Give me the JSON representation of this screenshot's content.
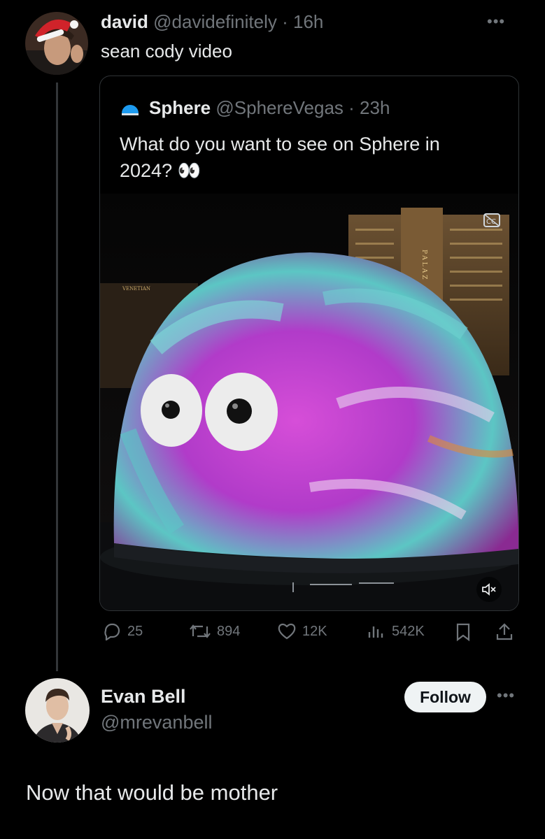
{
  "tweet": {
    "author_name": "david",
    "author_handle": "@davidefinitely",
    "time": "· 16h",
    "text": "sean cody video"
  },
  "quote": {
    "author_name": "Sphere",
    "author_handle": "@SphereVegas",
    "time": "· 23h",
    "text_line1": "What do you want to see on Sphere in",
    "text_line2": "2024?",
    "emoji": "👀",
    "media_sign": "PALAZ",
    "media_sign2": "VENETIAN"
  },
  "actions": {
    "replies": "25",
    "retweets": "894",
    "likes": "12K",
    "views": "542K"
  },
  "reply": {
    "author_name": "Evan Bell",
    "author_handle": "@mrevanbell",
    "follow_label": "Follow",
    "text": "Now that would be mother"
  },
  "colors": {
    "background": "#000000",
    "text": "#e7e9ea",
    "muted": "#71767b",
    "border": "#2f3336",
    "sphere_logo": "#1d9bf0"
  },
  "icons": [
    "more-icon",
    "sphere-logo-icon",
    "eyes-emoji",
    "cc-icon",
    "mute-icon",
    "reply-icon",
    "retweet-icon",
    "like-icon",
    "views-icon",
    "bookmark-icon",
    "share-icon"
  ]
}
